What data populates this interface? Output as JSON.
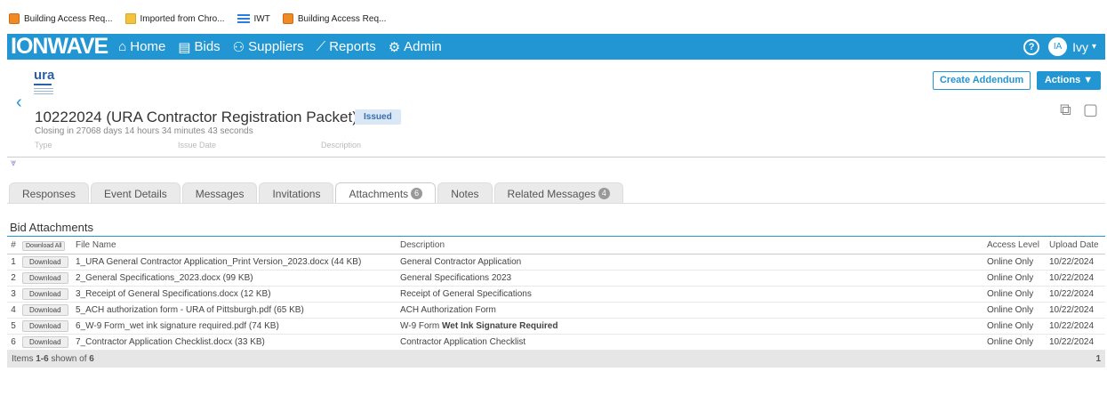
{
  "bookmarks": [
    {
      "label": "Building Access Req...",
      "icon": "orange-app-icon"
    },
    {
      "label": "Imported from Chro...",
      "icon": "folder-icon"
    },
    {
      "label": "IWT",
      "icon": "iwt-icon"
    },
    {
      "label": "Building Access Req...",
      "icon": "orange-app-icon"
    }
  ],
  "nav": {
    "logo": "IONWAVE",
    "items": [
      {
        "label": "Home",
        "icon": "⌂"
      },
      {
        "label": "Bids",
        "icon": "▤"
      },
      {
        "label": "Suppliers",
        "icon": "⚇"
      },
      {
        "label": "Reports",
        "icon": "⟋"
      },
      {
        "label": "Admin",
        "icon": "⚙"
      }
    ],
    "help": "?",
    "avatar": "IA",
    "user": "Ivy",
    "caret": "▾"
  },
  "header": {
    "org_logo": "ura",
    "back": "‹",
    "title": "10222024 (URA Contractor Registration Packet)",
    "status": "Issued",
    "closing": "Closing in 27068 days 14 hours 34 minutes 43 seconds",
    "meta": {
      "type": "Type",
      "issue_date": "Issue Date",
      "description": "Description"
    },
    "expand": "⩔",
    "create_addendum": "Create Addendum",
    "actions": "Actions ▼"
  },
  "tabs": [
    {
      "label": "Responses",
      "count": null,
      "active": false
    },
    {
      "label": "Event Details",
      "count": null,
      "active": false
    },
    {
      "label": "Messages",
      "count": null,
      "active": false
    },
    {
      "label": "Invitations",
      "count": null,
      "active": false
    },
    {
      "label": "Attachments",
      "count": "6",
      "active": true
    },
    {
      "label": "Notes",
      "count": null,
      "active": false
    },
    {
      "label": "Related Messages",
      "count": "4",
      "active": false
    }
  ],
  "attachments": {
    "section_title": "Bid Attachments",
    "columns": {
      "num": "#",
      "download_all": "Download All",
      "file": "File Name",
      "desc": "Description",
      "access": "Access Level",
      "date": "Upload Date"
    },
    "download_label": "Download",
    "rows": [
      {
        "num": "1",
        "file": "1_URA General Contractor Application_Print Version_2023.docx (44 KB)",
        "desc": "General Contractor Application",
        "desc_bold": "",
        "access": "Online Only",
        "date": "10/22/2024"
      },
      {
        "num": "2",
        "file": "2_General Specifications_2023.docx (99 KB)",
        "desc": "General Specifications 2023",
        "desc_bold": "",
        "access": "Online Only",
        "date": "10/22/2024"
      },
      {
        "num": "3",
        "file": "3_Receipt of General Specifications.docx (12 KB)",
        "desc": "Receipt of General Specifications",
        "desc_bold": "",
        "access": "Online Only",
        "date": "10/22/2024"
      },
      {
        "num": "4",
        "file": "5_ACH authorization form - URA of Pittsburgh.pdf (65 KB)",
        "desc": "ACH Authorization Form",
        "desc_bold": "",
        "access": "Online Only",
        "date": "10/22/2024"
      },
      {
        "num": "5",
        "file": "6_W-9 Form_wet ink signature required.pdf (74 KB)",
        "desc": "W-9 Form ",
        "desc_bold": "Wet Ink Signature Required",
        "access": "Online Only",
        "date": "10/22/2024"
      },
      {
        "num": "6",
        "file": "7_Contractor Application Checklist.docx (33 KB)",
        "desc": "Contractor Application Checklist",
        "desc_bold": "",
        "access": "Online Only",
        "date": "10/22/2024"
      }
    ],
    "footer_prefix": "Items ",
    "footer_range": "1-6",
    "footer_mid": " shown of ",
    "footer_total": "6",
    "page": "1"
  }
}
